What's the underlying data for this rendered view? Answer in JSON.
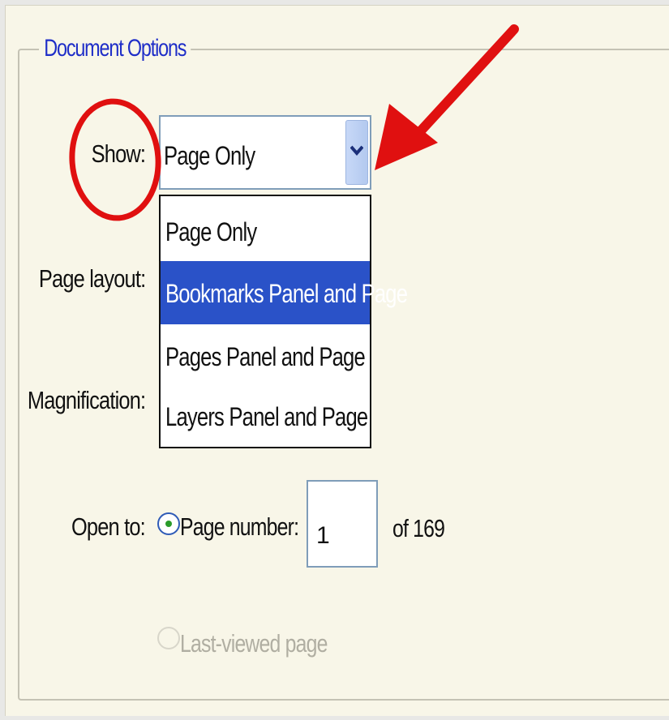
{
  "group": {
    "title": "Document Options"
  },
  "labels": {
    "show": "Show:",
    "page_layout": "Page layout:",
    "magnification": "Magnification:",
    "open_to": "Open to:"
  },
  "show_select": {
    "value": "Page Only",
    "options": [
      "Page Only",
      "Bookmarks Panel and Page",
      "Pages Panel and Page",
      "Layers Panel and Page"
    ],
    "highlighted_option": "Bookmarks Panel and Page"
  },
  "open_to": {
    "page_number_label": "Page number:",
    "page_number_value": "1",
    "of_total": "of 169",
    "last_viewed_label": "Last-viewed page"
  },
  "colors": {
    "legend_text": "#1f2ec8",
    "highlight": "#2a52c8",
    "annotation": "#e01010",
    "panel_bg": "#f8f6e8"
  },
  "annotations": [
    "red-circle-around-show-label",
    "red-arrow-to-dropdown-button"
  ]
}
